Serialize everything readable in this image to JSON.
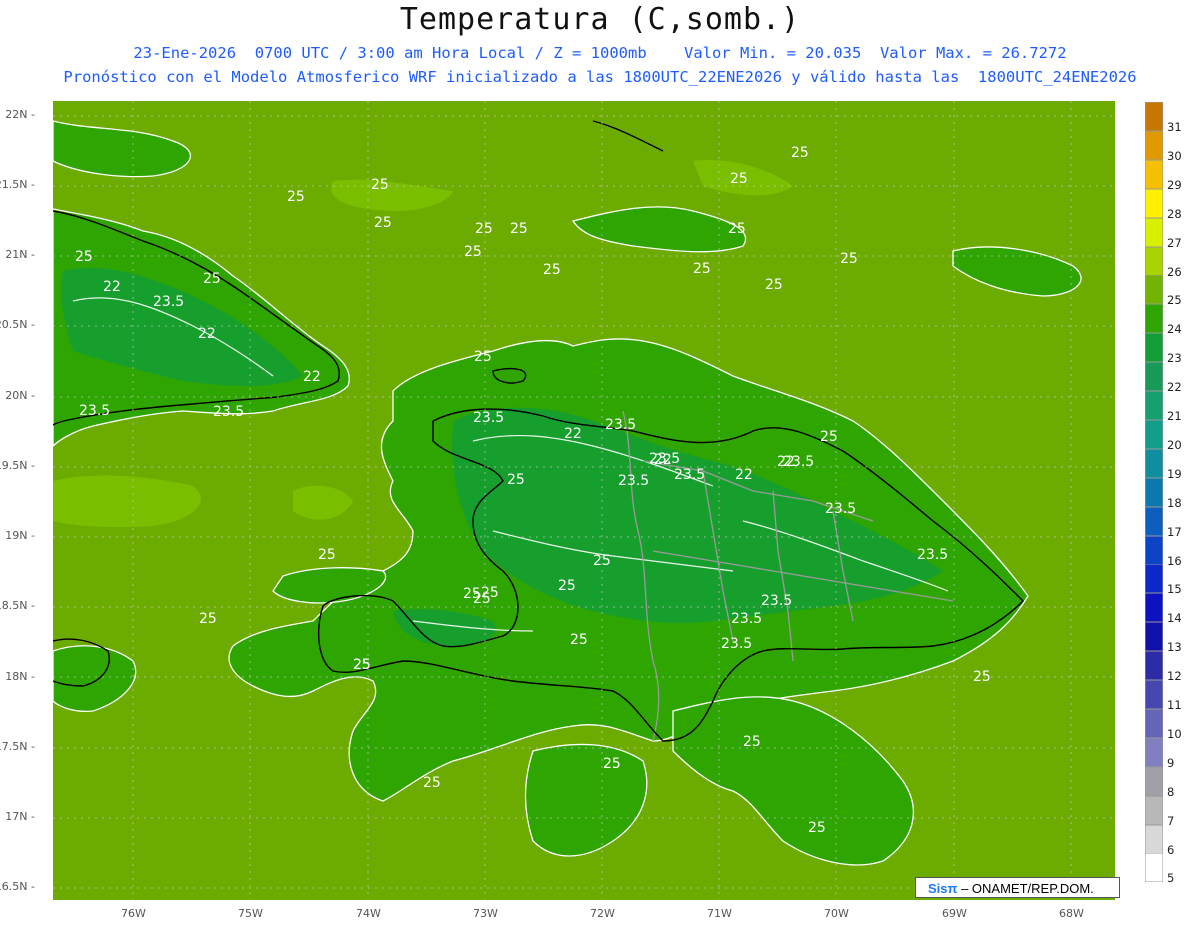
{
  "title": "Temperatura (C,somb.)",
  "subtitle_line1": "23-Ene-2026  0700 UTC / 3:00 am Hora Local / Z = 1000mb    Valor Min. = 20.035  Valor Max. = 26.7272",
  "subtitle_line2": "Pronóstico con el Modelo Atmosferico WRF inicializado a las 1800UTC_22ENE2026 y válido hasta las  1800UTC_24ENE2026",
  "lat_labels": [
    "22N",
    "21.5N",
    "21N",
    "20.5N",
    "20N",
    "19.5N",
    "19N",
    "18.5N",
    "18N",
    "17.5N",
    "17N",
    "16.5N"
  ],
  "lon_labels": [
    "76W",
    "75W",
    "74W",
    "73W",
    "72W",
    "71W",
    "70W",
    "69W",
    "68W"
  ],
  "colorbar": {
    "labels": [
      "31",
      "30",
      "29",
      "28",
      "27",
      "26",
      "25",
      "24",
      "23",
      "22",
      "21",
      "20",
      "19",
      "18",
      "17",
      "16",
      "15",
      "14",
      "13",
      "12",
      "11",
      "10",
      "9",
      "8",
      "7",
      "6",
      "5"
    ],
    "colors": [
      "#c87800",
      "#e09a00",
      "#f5c000",
      "#ffef00",
      "#d7f000",
      "#a8d400",
      "#72b400",
      "#2ea500",
      "#139e35",
      "#1a9a58",
      "#16a070",
      "#139e8c",
      "#0e8e9e",
      "#0b78ae",
      "#0c5fbe",
      "#0d43c7",
      "#0d28c8",
      "#0c12c0",
      "#1111aa",
      "#2c2ca6",
      "#4747b0",
      "#6464b8",
      "#8080c0",
      "#a0a0a8",
      "#b8b8b8",
      "#d8d8d8",
      "#ffffff"
    ]
  },
  "contour_labels": [
    "25",
    "25",
    "25",
    "25",
    "25",
    "25",
    "25",
    "25",
    "25",
    "25",
    "25",
    "25",
    "25",
    "25",
    "25",
    "22",
    "23.5",
    "22",
    "22",
    "23.5",
    "23.5",
    "25",
    "23.5",
    "23.5",
    "22",
    "23.5",
    "22",
    "23.5",
    "23.5",
    "22",
    "22",
    "23.5",
    "25",
    "25",
    "23.5",
    "23.5",
    "25",
    "25",
    "25",
    "23.5",
    "23.5",
    "23.5",
    "25",
    "25",
    "25",
    "25",
    "25",
    "25",
    "25",
    "25",
    "25",
    "25",
    "25",
    "25"
  ],
  "credit": {
    "brand": "Sisπ",
    "text": "– ONAMET/REP.DOM."
  }
}
